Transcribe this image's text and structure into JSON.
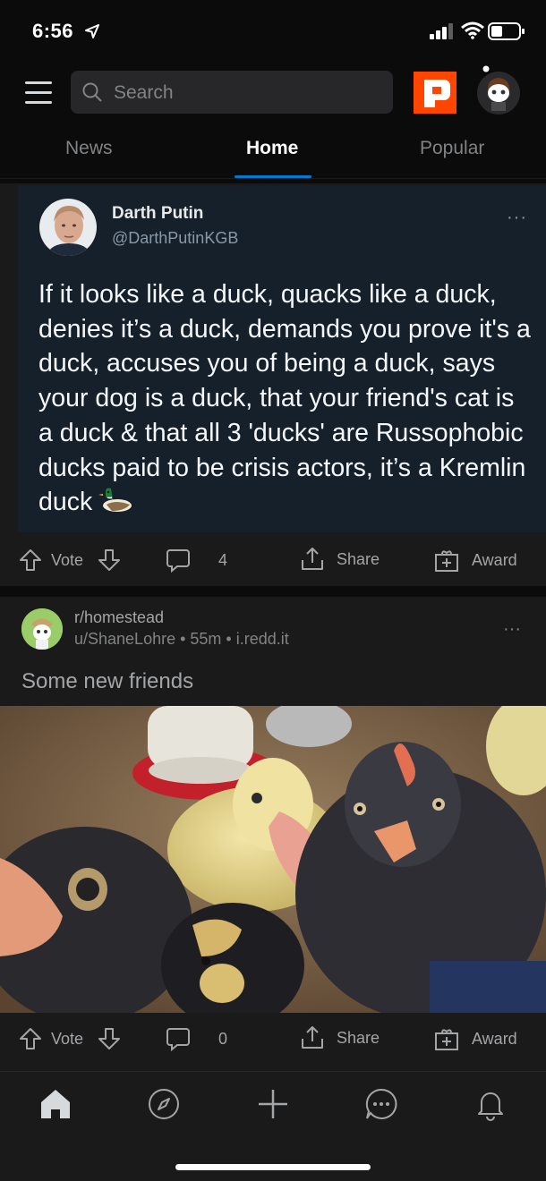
{
  "status_bar": {
    "time": "6:56"
  },
  "header": {
    "search_placeholder": "Search"
  },
  "tabs": [
    {
      "label": "News"
    },
    {
      "label": "Home"
    },
    {
      "label": "Popular"
    }
  ],
  "active_tab": "Home",
  "post1": {
    "tweet": {
      "author_name": "Darth Putin",
      "author_handle": "@DarthPutinKGB",
      "more": "···",
      "text": "If it looks like a duck, quacks like a duck, denies it’s a duck, demands you prove it's a duck, accuses you of being a duck, says your dog is a duck, that your friend's cat is a duck & that all 3 'ducks' are Russophobic ducks paid to be crisis actors, it’s a Kremlin duck"
    },
    "actions": {
      "vote_label": "Vote",
      "comment_count": "4",
      "share_label": "Share",
      "award_label": "Award"
    }
  },
  "post2": {
    "subreddit": "r/homestead",
    "meta": "u/ShaneLohre • 55m • i.redd.it",
    "more": "···",
    "title": "Some new friends",
    "actions": {
      "vote_label": "Vote",
      "comment_count": "0",
      "share_label": "Share",
      "award_label": "Award"
    }
  },
  "bottom_nav": [
    {
      "icon": "home-icon",
      "active": true
    },
    {
      "icon": "compass-icon",
      "active": false
    },
    {
      "icon": "plus-icon",
      "active": false
    },
    {
      "icon": "chat-icon",
      "active": false
    },
    {
      "icon": "bell-icon",
      "active": false
    }
  ],
  "colors": {
    "accent": "#0079d3",
    "brand": "#ff4500",
    "tweet_bg": "#15202b",
    "card_bg": "#1a1a1b"
  }
}
